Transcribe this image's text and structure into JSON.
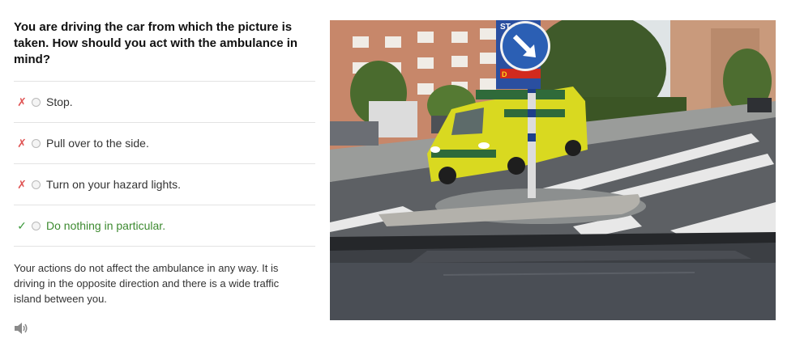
{
  "question": "You are driving the car from which the picture is taken. How should you act with the ambulance in mind?",
  "options": [
    {
      "label": "Stop.",
      "mark": "✗",
      "status": "wrong"
    },
    {
      "label": "Pull over to the side.",
      "mark": "✗",
      "status": "wrong"
    },
    {
      "label": "Turn on your hazard lights.",
      "mark": "✗",
      "status": "wrong"
    },
    {
      "label": "Do nothing in particular.",
      "mark": "✓",
      "status": "correct"
    }
  ],
  "explanation": "Your actions do not affect the ambulance in any way. It is driving in the opposite direction and there is a wide traffic island between you.",
  "audio": {
    "icon": "speaker-icon"
  },
  "photo": {
    "sign_letters": "ST",
    "shop_sign": "D"
  },
  "colors": {
    "wrong": "#e05555",
    "correct": "#3d8a30",
    "divider": "#e3e3e3"
  }
}
